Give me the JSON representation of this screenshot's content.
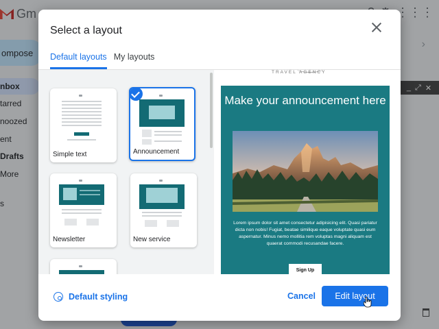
{
  "background": {
    "app_name": "Gm",
    "compose_label": "ompose",
    "sidebar": [
      "nbox",
      "tarred",
      "noozed",
      "ent",
      "Drafts",
      "More",
      "s"
    ]
  },
  "dialog": {
    "title": "Select a layout",
    "tabs": [
      "Default layouts",
      "My layouts"
    ],
    "active_tab": "Default layouts",
    "layouts": [
      {
        "label": "Simple text",
        "selected": false
      },
      {
        "label": "Announcement",
        "selected": true
      },
      {
        "label": "Newsletter",
        "selected": false
      },
      {
        "label": "New service",
        "selected": false
      }
    ],
    "preview": {
      "brand": "TRAVEL AGENCY",
      "headline": "Make your announcement here",
      "body": "Lorem ipsum dolor sit amet consectetur adipisicing elit. Quasi pariatur dicta non nobis! Fugiat, beatae similique eaque voluptate quasi eum aspernatur. Minus nemo mollitia rem voluptas magni aliquam est quaerat commodi recusandae facere.",
      "button": "Sign Up"
    },
    "footer": {
      "styling_label": "Default styling",
      "cancel_label": "Cancel",
      "edit_label": "Edit layout"
    }
  },
  "colors": {
    "accent": "#1a73e8",
    "teal": "#1a7a82"
  },
  "icons": {
    "close": "close-icon",
    "palette": "palette-icon",
    "check": "check-icon"
  }
}
